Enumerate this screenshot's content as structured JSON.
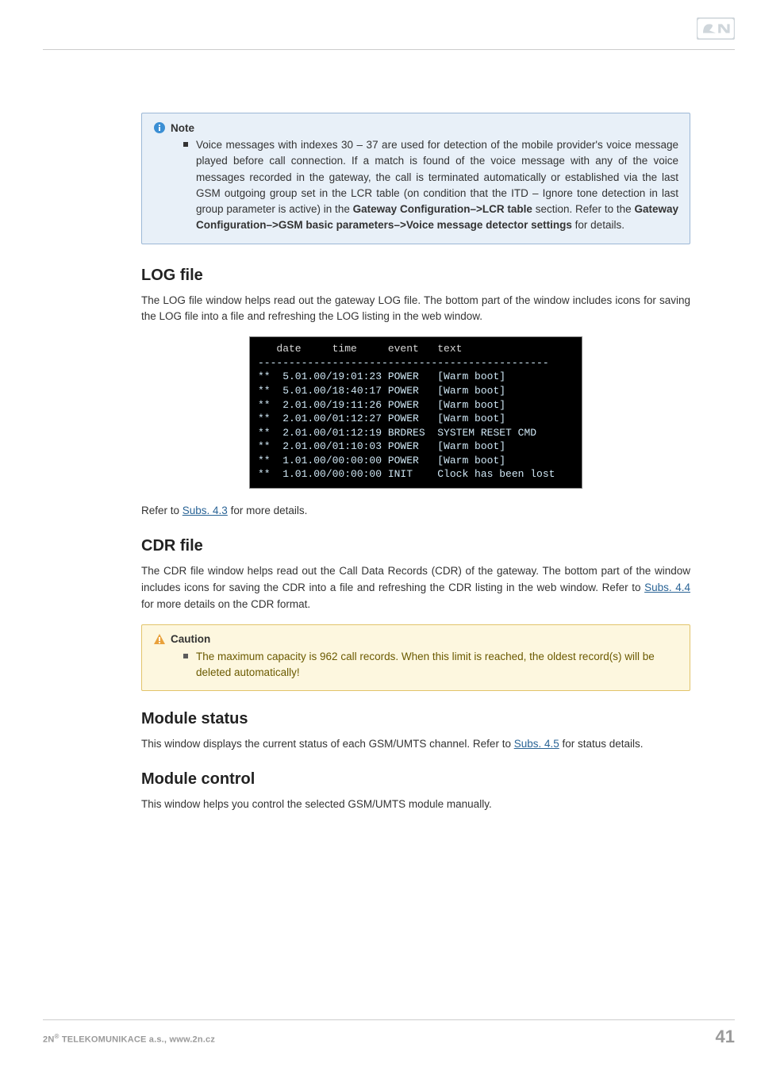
{
  "note": {
    "title": "Note",
    "body_pre": "Voice messages with indexes 30 – 37 are used for detection of the mobile provider's voice message played before call connection. If a match is found of the voice message with any of the voice messages recorded in the gateway, the call is terminated automatically or established via the last GSM outgoing group set in the LCR table (on condition that the ITD – Ignore tone detection in last group parameter is active) in the ",
    "b1": "Gateway Configuration–>LCR table",
    "mid1": " section. Refer to the ",
    "b2": "Gateway Configuration–>GSM basic parameters–>Voice message detector settings",
    "body_post2": " for details."
  },
  "log": {
    "heading": "LOG file",
    "para": "The LOG file window helps read out the gateway LOG file. The bottom part of the window includes icons for saving the LOG file into a file and refreshing the LOG listing in the web window.",
    "header_line": "   date     time     event   text",
    "rows": [
      "**  5.01.00/19:01:23 POWER   [Warm boot]",
      "**  5.01.00/18:40:17 POWER   [Warm boot]",
      "**  2.01.00/19:11:26 POWER   [Warm boot]",
      "**  2.01.00/01:12:27 POWER   [Warm boot]",
      "**  2.01.00/01:12:19 BRDRES  SYSTEM RESET CMD",
      "**  2.01.00/01:10:03 POWER   [Warm boot]",
      "**  1.01.00/00:00:00 POWER   [Warm boot]",
      "**  1.01.00/00:00:00 INIT    Clock has been lost"
    ],
    "refer_pre": "Refer to ",
    "refer_link": "Subs. 4.3",
    "refer_post": " for more details."
  },
  "cdr": {
    "heading": "CDR file",
    "para_pre": "The CDR file window helps read out the Call Data Records (CDR) of the gateway. The bottom part of the window includes icons for saving the CDR into a file and refreshing the CDR listing in the web window. Refer to ",
    "link": "Subs. 4.4",
    "para_post": " for more details on the CDR format."
  },
  "caution": {
    "title": "Caution",
    "body": "The maximum capacity is 962 call records. When this limit is reached, the oldest record(s) will be deleted automatically!"
  },
  "modstatus": {
    "heading": "Module status",
    "para_pre": "This window displays the current status of each GSM/UMTS channel. Refer to ",
    "link": "Subs. 4.5",
    "para_post": "  for status details."
  },
  "modcontrol": {
    "heading": "Module control",
    "para": "This window helps you control the selected GSM/UMTS module manually."
  },
  "footer": {
    "left_pre": "2N",
    "left_sup": "®",
    "left_post": " TELEKOMUNIKACE a.s., www.2n.cz",
    "pageno": "41"
  }
}
